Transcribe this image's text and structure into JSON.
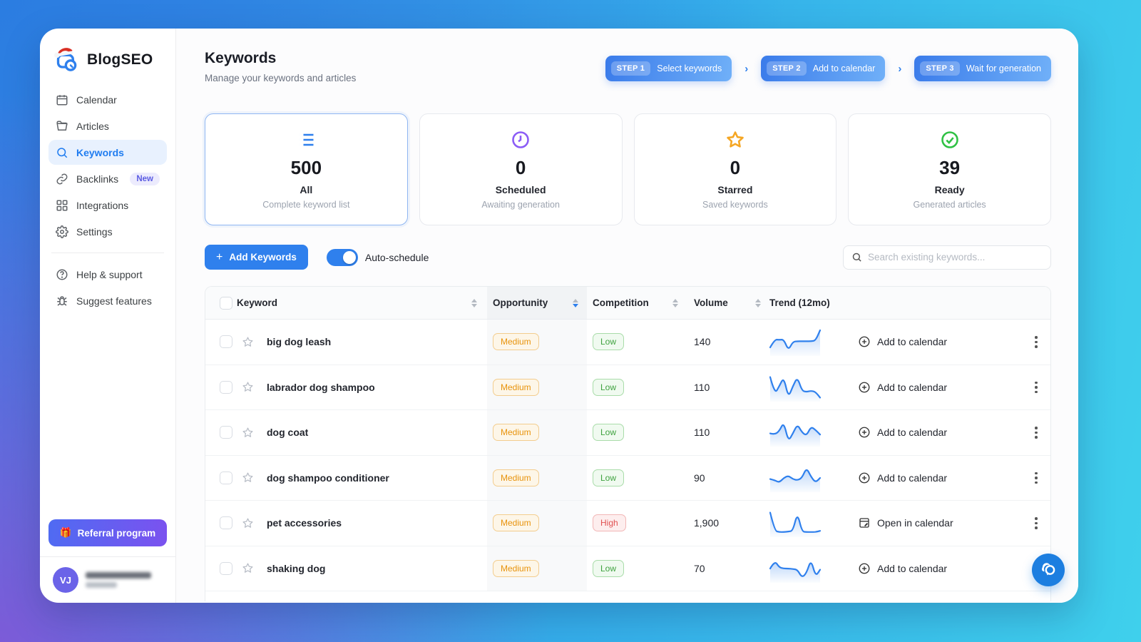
{
  "app": {
    "name": "BlogSEO"
  },
  "sidebar": {
    "items": [
      {
        "label": "Calendar",
        "icon": "calendar-icon"
      },
      {
        "label": "Articles",
        "icon": "folder-icon"
      },
      {
        "label": "Keywords",
        "icon": "search-icon",
        "active": true
      },
      {
        "label": "Backlinks",
        "icon": "link-icon",
        "badge": "New"
      },
      {
        "label": "Integrations",
        "icon": "grid-icon"
      },
      {
        "label": "Settings",
        "icon": "gear-icon"
      },
      {
        "label": "Help & support",
        "icon": "help-icon"
      },
      {
        "label": "Suggest features",
        "icon": "bug-icon"
      }
    ],
    "referral": {
      "label": "Referral program",
      "icon": "gift-icon",
      "emoji": "🎁"
    },
    "user": {
      "initials": "VJ",
      "name_redacted": true
    }
  },
  "header": {
    "title": "Keywords",
    "subtitle": "Manage your keywords and articles",
    "steps": [
      {
        "badge": "STEP 1",
        "label": "Select keywords"
      },
      {
        "badge": "STEP 2",
        "label": "Add to calendar"
      },
      {
        "badge": "STEP 3",
        "label": "Wait for generation"
      }
    ],
    "step_separator": "›"
  },
  "stats": [
    {
      "icon": "list-icon",
      "color": "#2f80ed",
      "value": "500",
      "label": "All",
      "sub": "Complete keyword list",
      "selected": true
    },
    {
      "icon": "clock-icon",
      "color": "#8b5cf6",
      "value": "0",
      "label": "Scheduled",
      "sub": "Awaiting generation",
      "selected": false
    },
    {
      "icon": "star-icon",
      "color": "#f5a623",
      "value": "0",
      "label": "Starred",
      "sub": "Saved keywords",
      "selected": false
    },
    {
      "icon": "check-circle-icon",
      "color": "#2fc144",
      "value": "39",
      "label": "Ready",
      "sub": "Generated articles",
      "selected": false
    }
  ],
  "controls": {
    "add_button": "Add Keywords",
    "add_plus": "+",
    "auto_schedule_label": "Auto-schedule",
    "auto_schedule_on": true,
    "search_placeholder": "Search existing keywords..."
  },
  "table": {
    "columns": {
      "keyword": "Keyword",
      "opportunity": "Opportunity",
      "competition": "Competition",
      "volume": "Volume",
      "trend": "Trend (12mo)"
    },
    "sorted_by": "Opportunity",
    "sort_direction": "desc",
    "rows": [
      {
        "keyword": "big dog leash",
        "opportunity": "Medium",
        "competition": "Low",
        "volume": "140",
        "action": "Add to calendar",
        "action_icon": "plus-circle-icon",
        "trend": [
          0.25,
          0.6,
          0.58,
          0.6,
          0.12,
          0.5,
          0.52,
          0.52,
          0.52,
          0.52,
          0.55,
          1.0
        ]
      },
      {
        "keyword": "labrador dog shampoo",
        "opportunity": "Medium",
        "competition": "Low",
        "volume": "110",
        "action": "Add to calendar",
        "action_icon": "plus-circle-icon",
        "trend": [
          0.95,
          0.2,
          0.55,
          0.95,
          0.05,
          0.55,
          0.95,
          0.35,
          0.3,
          0.35,
          0.3,
          0.05
        ]
      },
      {
        "keyword": "dog coat",
        "opportunity": "Medium",
        "competition": "Low",
        "volume": "110",
        "action": "Add to calendar",
        "action_icon": "plus-circle-icon",
        "trend": [
          0.45,
          0.4,
          0.55,
          0.95,
          0.1,
          0.45,
          0.85,
          0.5,
          0.35,
          0.75,
          0.6,
          0.4
        ]
      },
      {
        "keyword": "dog shampoo conditioner",
        "opportunity": "Medium",
        "competition": "Low",
        "volume": "90",
        "action": "Add to calendar",
        "action_icon": "plus-circle-icon",
        "trend": [
          0.45,
          0.4,
          0.3,
          0.5,
          0.6,
          0.45,
          0.4,
          0.5,
          0.95,
          0.55,
          0.3,
          0.5
        ]
      },
      {
        "keyword": "pet accessories",
        "opportunity": "Medium",
        "competition": "High",
        "volume": "1,900",
        "action": "Open in calendar",
        "action_icon": "calendar-edit-icon",
        "trend": [
          0.95,
          0.15,
          0.1,
          0.1,
          0.12,
          0.15,
          0.95,
          0.12,
          0.1,
          0.1,
          0.1,
          0.15
        ]
      },
      {
        "keyword": "shaking dog",
        "opportunity": "Medium",
        "competition": "Low",
        "volume": "70",
        "action": "Add to calendar",
        "action_icon": "plus-circle-icon",
        "trend": [
          0.5,
          0.85,
          0.55,
          0.5,
          0.5,
          0.48,
          0.45,
          0.1,
          0.3,
          0.9,
          0.15,
          0.45
        ]
      }
    ]
  },
  "colors": {
    "accent": "#2f80ed",
    "spark_line": "#2f80ed"
  }
}
